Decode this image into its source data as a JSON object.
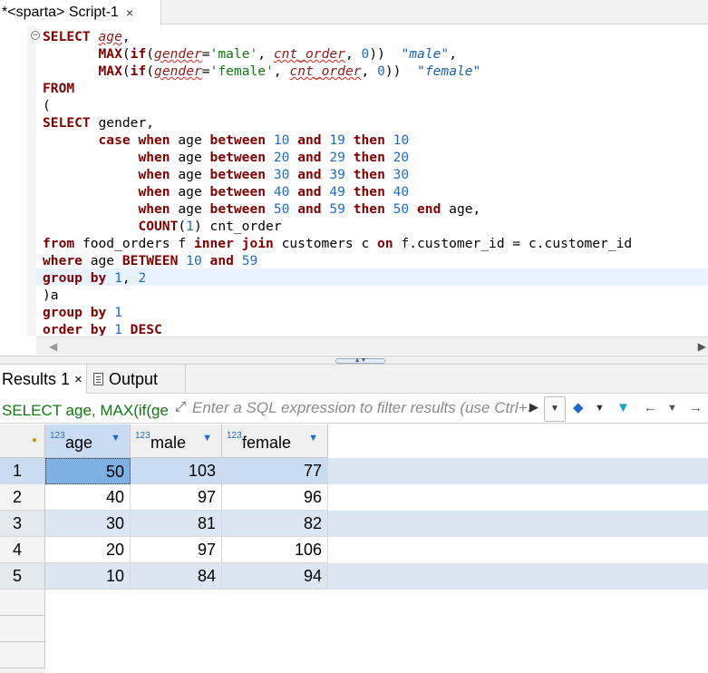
{
  "editor_tab": {
    "label": "*<sparta> Script-1",
    "close": "×"
  },
  "sql_lines": [
    [
      {
        "t": "SELECT ",
        "c": "kw"
      },
      {
        "t": "age",
        "c": "err"
      },
      {
        "t": ",",
        "c": ""
      }
    ],
    [
      {
        "t": "       ",
        "c": ""
      },
      {
        "t": "MAX",
        "c": "kw"
      },
      {
        "t": "(",
        "c": ""
      },
      {
        "t": "if",
        "c": "kw"
      },
      {
        "t": "(",
        "c": ""
      },
      {
        "t": "gender",
        "c": "err"
      },
      {
        "t": "=",
        "c": ""
      },
      {
        "t": "'male'",
        "c": "str"
      },
      {
        "t": ", ",
        "c": ""
      },
      {
        "t": "cnt_order",
        "c": "err"
      },
      {
        "t": ", ",
        "c": ""
      },
      {
        "t": "0",
        "c": "num"
      },
      {
        "t": "))  ",
        "c": ""
      },
      {
        "t": "\"male\"",
        "c": "ident"
      },
      {
        "t": ",",
        "c": ""
      }
    ],
    [
      {
        "t": "       ",
        "c": ""
      },
      {
        "t": "MAX",
        "c": "kw"
      },
      {
        "t": "(",
        "c": ""
      },
      {
        "t": "if",
        "c": "kw"
      },
      {
        "t": "(",
        "c": ""
      },
      {
        "t": "gender",
        "c": "err"
      },
      {
        "t": "=",
        "c": ""
      },
      {
        "t": "'female'",
        "c": "str"
      },
      {
        "t": ", ",
        "c": ""
      },
      {
        "t": "cnt_order",
        "c": "err"
      },
      {
        "t": ", ",
        "c": ""
      },
      {
        "t": "0",
        "c": "num"
      },
      {
        "t": "))  ",
        "c": ""
      },
      {
        "t": "\"female\"",
        "c": "ident"
      }
    ],
    [
      {
        "t": "FROM",
        "c": "kw"
      }
    ],
    [
      {
        "t": "(",
        "c": ""
      }
    ],
    [
      {
        "t": "SELECT ",
        "c": "kw"
      },
      {
        "t": "gender,",
        "c": ""
      }
    ],
    [
      {
        "t": "       ",
        "c": ""
      },
      {
        "t": "case when ",
        "c": "kw"
      },
      {
        "t": "age ",
        "c": ""
      },
      {
        "t": "between ",
        "c": "kw"
      },
      {
        "t": "10",
        "c": "num"
      },
      {
        "t": " and ",
        "c": "kw"
      },
      {
        "t": "19",
        "c": "num"
      },
      {
        "t": " then ",
        "c": "kw"
      },
      {
        "t": "10",
        "c": "num"
      }
    ],
    [
      {
        "t": "            ",
        "c": ""
      },
      {
        "t": "when ",
        "c": "kw"
      },
      {
        "t": "age ",
        "c": ""
      },
      {
        "t": "between ",
        "c": "kw"
      },
      {
        "t": "20",
        "c": "num"
      },
      {
        "t": " and ",
        "c": "kw"
      },
      {
        "t": "29",
        "c": "num"
      },
      {
        "t": " then ",
        "c": "kw"
      },
      {
        "t": "20",
        "c": "num"
      }
    ],
    [
      {
        "t": "            ",
        "c": ""
      },
      {
        "t": "when ",
        "c": "kw"
      },
      {
        "t": "age ",
        "c": ""
      },
      {
        "t": "between ",
        "c": "kw"
      },
      {
        "t": "30",
        "c": "num"
      },
      {
        "t": " and ",
        "c": "kw"
      },
      {
        "t": "39",
        "c": "num"
      },
      {
        "t": " then ",
        "c": "kw"
      },
      {
        "t": "30",
        "c": "num"
      }
    ],
    [
      {
        "t": "            ",
        "c": ""
      },
      {
        "t": "when ",
        "c": "kw"
      },
      {
        "t": "age ",
        "c": ""
      },
      {
        "t": "between ",
        "c": "kw"
      },
      {
        "t": "40",
        "c": "num"
      },
      {
        "t": " and ",
        "c": "kw"
      },
      {
        "t": "49",
        "c": "num"
      },
      {
        "t": " then ",
        "c": "kw"
      },
      {
        "t": "40",
        "c": "num"
      }
    ],
    [
      {
        "t": "            ",
        "c": ""
      },
      {
        "t": "when ",
        "c": "kw"
      },
      {
        "t": "age ",
        "c": ""
      },
      {
        "t": "between ",
        "c": "kw"
      },
      {
        "t": "50",
        "c": "num"
      },
      {
        "t": " and ",
        "c": "kw"
      },
      {
        "t": "59",
        "c": "num"
      },
      {
        "t": " then ",
        "c": "kw"
      },
      {
        "t": "50",
        "c": "num"
      },
      {
        "t": " end ",
        "c": "kw"
      },
      {
        "t": "age,",
        "c": ""
      }
    ],
    [
      {
        "t": "            ",
        "c": ""
      },
      {
        "t": "COUNT",
        "c": "kw"
      },
      {
        "t": "(",
        "c": ""
      },
      {
        "t": "1",
        "c": "num"
      },
      {
        "t": ") cnt_order",
        "c": ""
      }
    ],
    [
      {
        "t": "from ",
        "c": "kw"
      },
      {
        "t": "food_orders f ",
        "c": ""
      },
      {
        "t": "inner join ",
        "c": "kw"
      },
      {
        "t": "customers c ",
        "c": ""
      },
      {
        "t": "on ",
        "c": "kw"
      },
      {
        "t": "f.customer_id = c.customer_id",
        "c": ""
      }
    ],
    [
      {
        "t": "where ",
        "c": "kw"
      },
      {
        "t": "age ",
        "c": ""
      },
      {
        "t": "BETWEEN ",
        "c": "kw"
      },
      {
        "t": "10",
        "c": "num"
      },
      {
        "t": " and ",
        "c": "kw"
      },
      {
        "t": "59",
        "c": "num"
      }
    ],
    [
      {
        "t": "group by ",
        "c": "kw"
      },
      {
        "t": "1",
        "c": "num"
      },
      {
        "t": ", ",
        "c": ""
      },
      {
        "t": "2",
        "c": "num"
      }
    ],
    [
      {
        "t": ")a",
        "c": ""
      }
    ],
    [
      {
        "t": "group by ",
        "c": "kw"
      },
      {
        "t": "1",
        "c": "num"
      }
    ],
    [
      {
        "t": "order by ",
        "c": "kw"
      },
      {
        "t": "1",
        "c": "num"
      },
      {
        "t": " DESC",
        "c": "kw"
      }
    ]
  ],
  "results_tabs": {
    "results": "Results 1",
    "results_close": "×",
    "output": "Output"
  },
  "filter": {
    "query_preview": "SELECT age, MAX(if(ge",
    "placeholder": "Enter a SQL expression to filter results (use Ctrl+Space)"
  },
  "grid": {
    "columns": [
      {
        "type": "123",
        "name": "age"
      },
      {
        "type": "123",
        "name": "male"
      },
      {
        "type": "123",
        "name": "female"
      }
    ],
    "rows": [
      [
        "1",
        "50",
        "103",
        "77"
      ],
      [
        "2",
        "40",
        "97",
        "96"
      ],
      [
        "3",
        "30",
        "81",
        "82"
      ],
      [
        "4",
        "20",
        "97",
        "106"
      ],
      [
        "5",
        "10",
        "84",
        "94"
      ]
    ]
  },
  "colors": {
    "keyword": "#7f0000",
    "number": "#1f6bc4",
    "string": "#117711",
    "selection": "#c9dcf2",
    "active_cell": "#7fb0e4"
  }
}
